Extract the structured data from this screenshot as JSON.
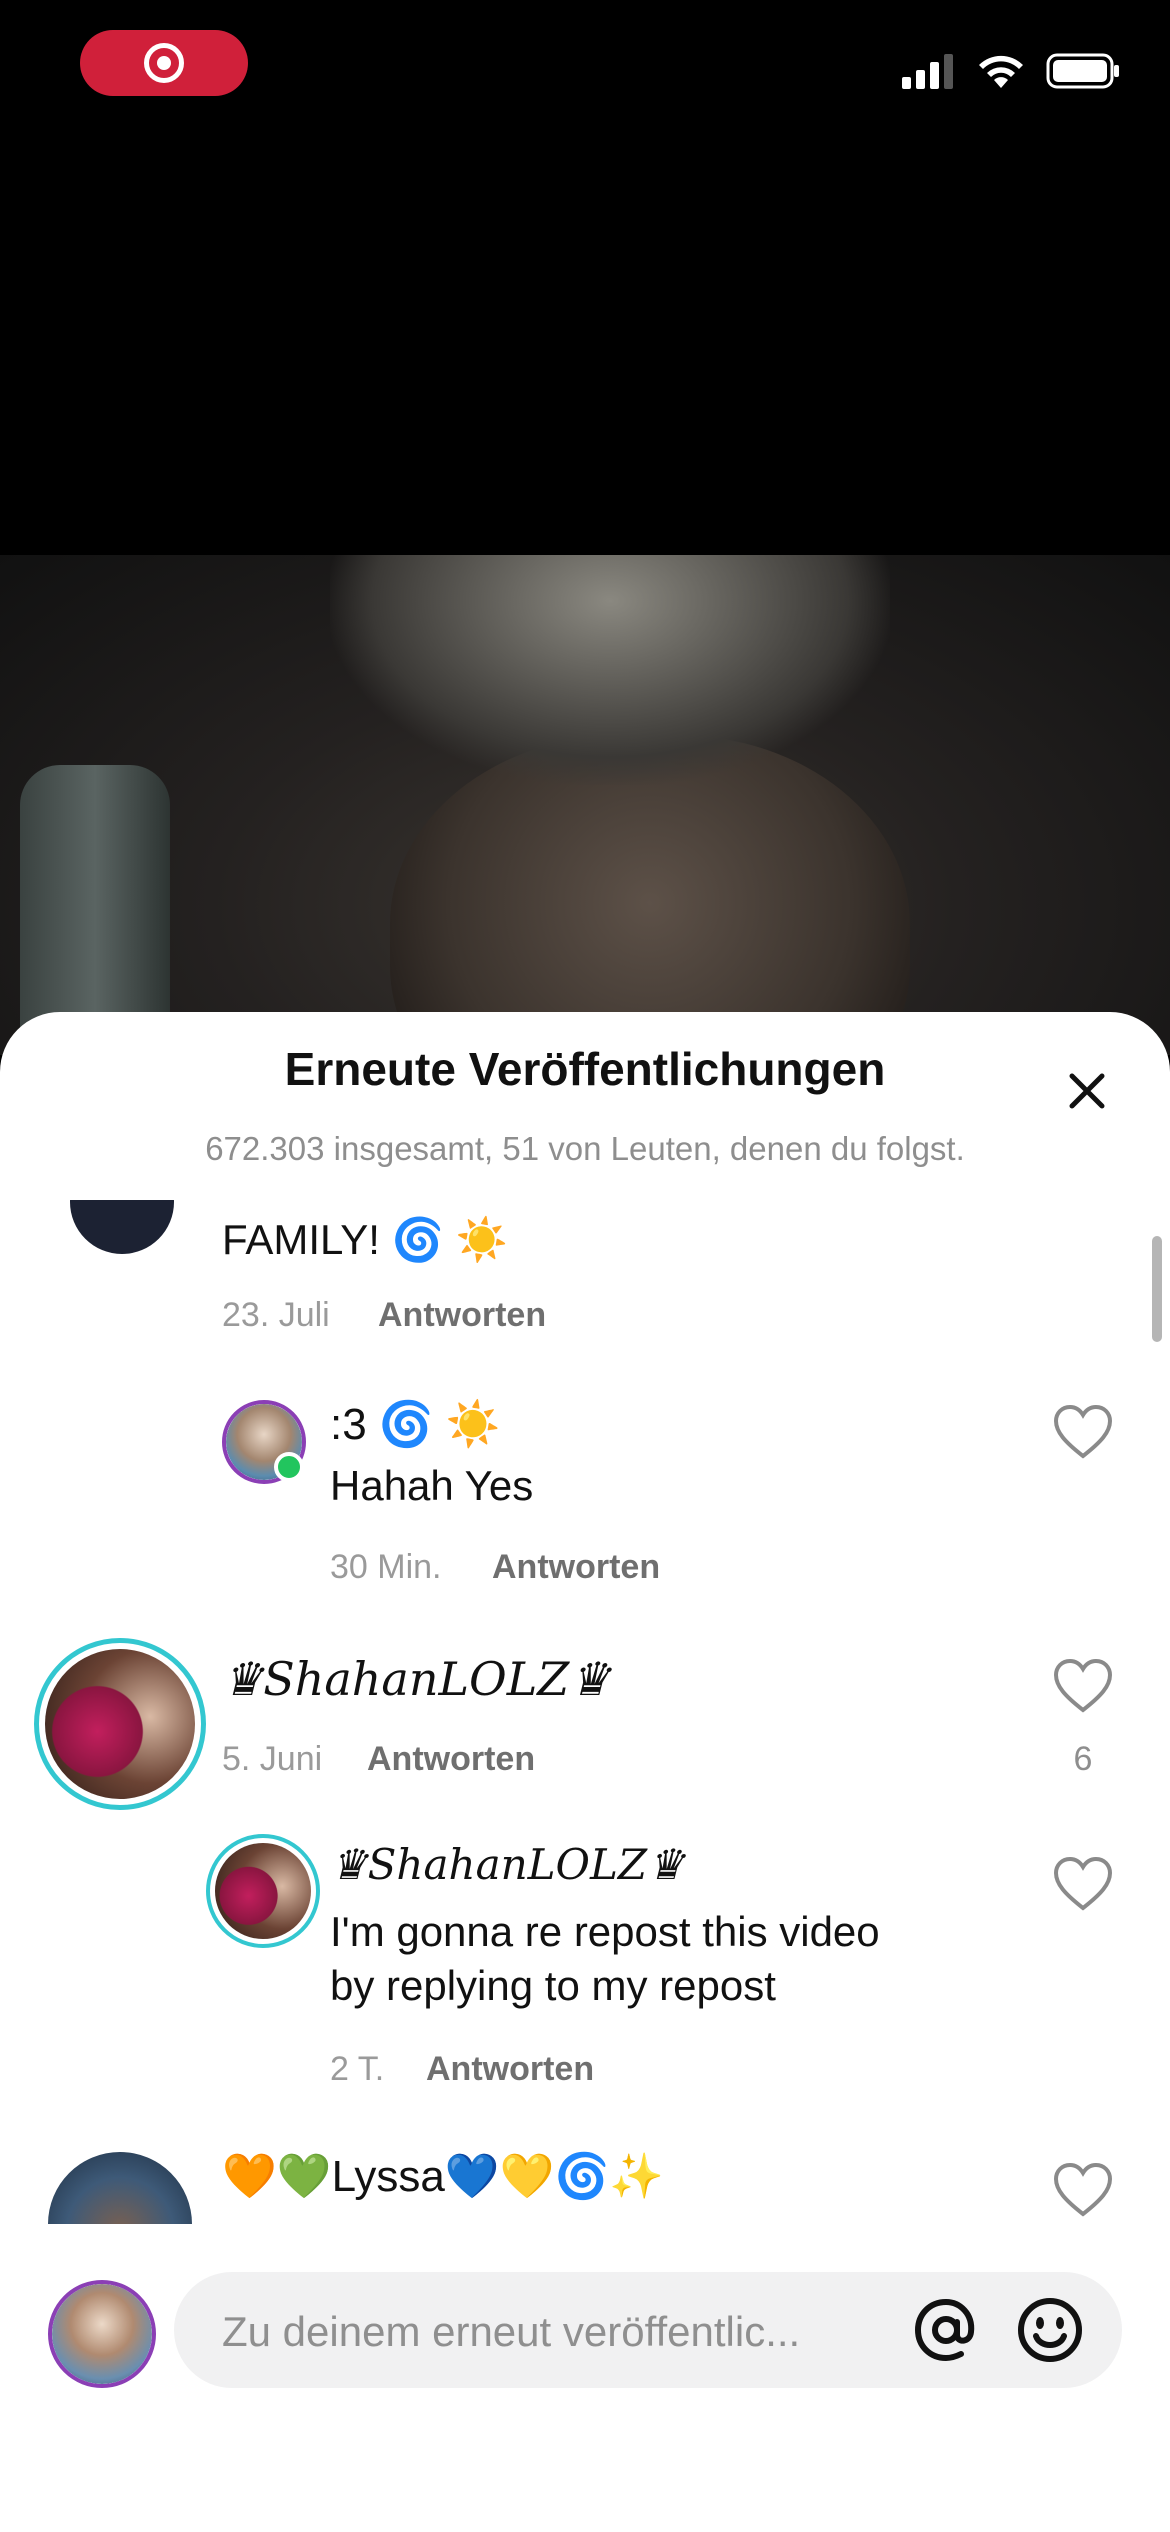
{
  "status_bar": {
    "record_icon": "record-icon",
    "signal": "cellular-signal-icon",
    "wifi": "wifi-icon",
    "battery": "battery-icon"
  },
  "sheet": {
    "title": "Erneute Veröffentlichungen",
    "subtitle": "672.303 insgesamt, 51 von Leuten, denen du folgst.",
    "close_icon": "close-icon"
  },
  "comments": [
    {
      "text": "FAMILY! 🌀 ☀️",
      "date": "23. Juli",
      "reply_label": "Antworten"
    },
    {
      "name": ":3 🌀 ☀️",
      "text": "Hahah Yes",
      "date": "30 Min.",
      "reply_label": "Antworten"
    },
    {
      "name": "♛𝑆ℎ𝑎ℎ𝑎𝑛𝐿𝑂𝐿𝑍♛",
      "date": "5. Juni",
      "reply_label": "Antworten",
      "likes": "6"
    },
    {
      "name": "♛𝑆ℎ𝑎ℎ𝑎𝑛𝐿𝑂𝐿𝑍♛",
      "text_line1": "I'm gonna re repost this video",
      "text_line2": "by replying to my repost",
      "date": "2 T.",
      "reply_label": "Antworten"
    },
    {
      "name": "🧡💚Lyssa💙💛🌀✨"
    }
  ],
  "input": {
    "placeholder": "Zu deinem erneut veröffentlic...",
    "at_icon": "at-icon",
    "emoji_icon": "emoji-icon"
  },
  "colors": {
    "accent_red": "#d0203a",
    "ring_teal": "#33c7d0",
    "online_green": "#22c55e"
  }
}
